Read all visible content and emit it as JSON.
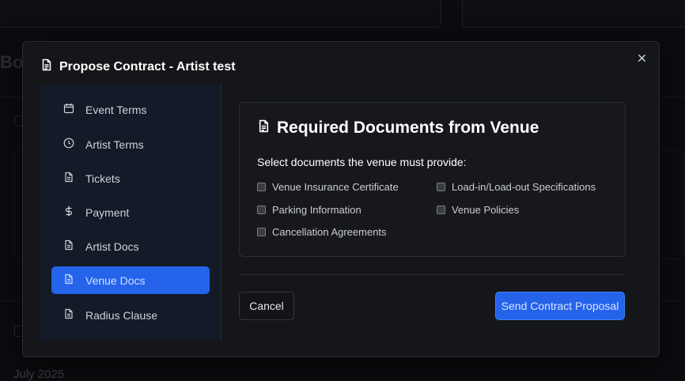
{
  "background": {
    "month_label": "July 2025"
  },
  "modal": {
    "title": "Propose Contract - Artist test",
    "close_icon": "close-icon",
    "sidebar": {
      "items": [
        {
          "label": "Event Terms",
          "icon": "calendar-icon",
          "active": false
        },
        {
          "label": "Artist Terms",
          "icon": "clock-icon",
          "active": false
        },
        {
          "label": "Tickets",
          "icon": "document-icon",
          "active": false
        },
        {
          "label": "Payment",
          "icon": "dollar-icon",
          "active": false
        },
        {
          "label": "Artist Docs",
          "icon": "document-icon",
          "active": false
        },
        {
          "label": "Venue Docs",
          "icon": "document-icon",
          "active": true
        },
        {
          "label": "Radius Clause",
          "icon": "document-icon",
          "active": false
        }
      ]
    },
    "section": {
      "title": "Required Documents from Venue",
      "subtitle": "Select documents the venue must provide:",
      "documents": [
        {
          "label": "Venue Insurance Certificate",
          "checked": false
        },
        {
          "label": "Load-in/Load-out Specifications",
          "checked": false
        },
        {
          "label": "Parking Information",
          "checked": false
        },
        {
          "label": "Venue Policies",
          "checked": false
        },
        {
          "label": "Cancellation Agreements",
          "checked": false
        }
      ]
    },
    "actions": {
      "cancel_label": "Cancel",
      "submit_label": "Send Contract Proposal"
    }
  },
  "colors": {
    "accent": "#2563eb",
    "modal_bg": "#151619",
    "sidebar_bg": "#131a28"
  }
}
